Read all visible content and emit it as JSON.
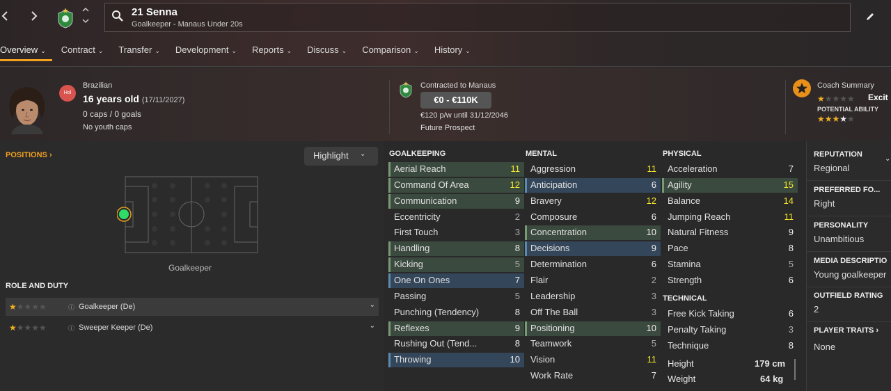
{
  "header": {
    "name": "21 Senna",
    "subtitle": "Goalkeeper - Manaus Under 20s",
    "back_icon": "chevron-left-icon",
    "forward_icon": "chevron-right-icon"
  },
  "tabs": [
    {
      "label": "Overview"
    },
    {
      "label": "Contract"
    },
    {
      "label": "Transfer"
    },
    {
      "label": "Development"
    },
    {
      "label": "Reports"
    },
    {
      "label": "Discuss"
    },
    {
      "label": "Comparison"
    },
    {
      "label": "History"
    }
  ],
  "profile": {
    "badge": "Hol",
    "nationality": "Brazilian",
    "age": "16 years old",
    "dob": "(17/11/2027)",
    "caps": "0 caps / 0 goals",
    "youth": "No youth caps"
  },
  "contract": {
    "title": "Contracted to Manaus",
    "wage_range": "€0 - €110K",
    "terms": "€120 p/w until 31/12/2046",
    "status": "Future Prospect"
  },
  "coach": {
    "title": "Coach Summary",
    "current": "Excit",
    "ca_stars": 1,
    "pa_label": "POTENTIAL ABILITY",
    "pa_stars": 3.5
  },
  "positions": {
    "label": "POSITIONS",
    "highlight": "Highlight",
    "position": "Goalkeeper"
  },
  "roles": {
    "label": "ROLE AND DUTY",
    "items": [
      {
        "name": "Goalkeeper (De)",
        "stars": 1
      },
      {
        "name": "Sweeper Keeper (De)",
        "stars": 1
      }
    ]
  },
  "goalkeeping": {
    "label": "GOALKEEPING",
    "items": [
      {
        "name": "Aerial Reach",
        "value": "11",
        "hl": "g",
        "col": "y"
      },
      {
        "name": "Command Of Area",
        "value": "12",
        "hl": "g",
        "col": "y"
      },
      {
        "name": "Communication",
        "value": "9",
        "hl": "g",
        "col": "w"
      },
      {
        "name": "Eccentricity",
        "value": "2",
        "hl": "",
        "col": "g"
      },
      {
        "name": "First Touch",
        "value": "3",
        "hl": "",
        "col": "g"
      },
      {
        "name": "Handling",
        "value": "8",
        "hl": "g",
        "col": "w"
      },
      {
        "name": "Kicking",
        "value": "5",
        "hl": "g",
        "col": "g"
      },
      {
        "name": "One On Ones",
        "value": "7",
        "hl": "b",
        "col": "w"
      },
      {
        "name": "Passing",
        "value": "5",
        "hl": "",
        "col": "g"
      },
      {
        "name": "Punching (Tendency)",
        "value": "8",
        "hl": "",
        "col": "w"
      },
      {
        "name": "Reflexes",
        "value": "9",
        "hl": "g",
        "col": "w"
      },
      {
        "name": "Rushing Out (Tend...",
        "value": "8",
        "hl": "",
        "col": "w"
      },
      {
        "name": "Throwing",
        "value": "10",
        "hl": "b",
        "col": "w"
      }
    ]
  },
  "mental": {
    "label": "MENTAL",
    "items": [
      {
        "name": "Aggression",
        "value": "11",
        "hl": "",
        "col": "y"
      },
      {
        "name": "Anticipation",
        "value": "6",
        "hl": "b",
        "col": "w"
      },
      {
        "name": "Bravery",
        "value": "12",
        "hl": "",
        "col": "y"
      },
      {
        "name": "Composure",
        "value": "6",
        "hl": "",
        "col": "w"
      },
      {
        "name": "Concentration",
        "value": "10",
        "hl": "g",
        "col": "w"
      },
      {
        "name": "Decisions",
        "value": "9",
        "hl": "b",
        "col": "w"
      },
      {
        "name": "Determination",
        "value": "6",
        "hl": "",
        "col": "w"
      },
      {
        "name": "Flair",
        "value": "2",
        "hl": "",
        "col": "g"
      },
      {
        "name": "Leadership",
        "value": "3",
        "hl": "",
        "col": "g"
      },
      {
        "name": "Off The Ball",
        "value": "3",
        "hl": "",
        "col": "g"
      },
      {
        "name": "Positioning",
        "value": "10",
        "hl": "g",
        "col": "w"
      },
      {
        "name": "Teamwork",
        "value": "5",
        "hl": "",
        "col": "g"
      },
      {
        "name": "Vision",
        "value": "11",
        "hl": "",
        "col": "y"
      },
      {
        "name": "Work Rate",
        "value": "7",
        "hl": "",
        "col": "w"
      }
    ]
  },
  "physical": {
    "label": "PHYSICAL",
    "items": [
      {
        "name": "Acceleration",
        "value": "7",
        "hl": "",
        "col": "w"
      },
      {
        "name": "Agility",
        "value": "15",
        "hl": "g",
        "col": "y"
      },
      {
        "name": "Balance",
        "value": "14",
        "hl": "",
        "col": "y"
      },
      {
        "name": "Jumping Reach",
        "value": "11",
        "hl": "",
        "col": "y"
      },
      {
        "name": "Natural Fitness",
        "value": "9",
        "hl": "",
        "col": "w"
      },
      {
        "name": "Pace",
        "value": "8",
        "hl": "",
        "col": "w"
      },
      {
        "name": "Stamina",
        "value": "5",
        "hl": "",
        "col": "g"
      },
      {
        "name": "Strength",
        "value": "6",
        "hl": "",
        "col": "w"
      }
    ]
  },
  "technical": {
    "label": "TECHNICAL",
    "items": [
      {
        "name": "Free Kick Taking",
        "value": "6",
        "hl": "",
        "col": "w"
      },
      {
        "name": "Penalty Taking",
        "value": "3",
        "hl": "",
        "col": "g"
      },
      {
        "name": "Technique",
        "value": "8",
        "hl": "",
        "col": "w"
      }
    ]
  },
  "body": {
    "height_label": "Height",
    "height": "179 cm",
    "weight_label": "Weight",
    "weight": "64 kg"
  },
  "side": [
    {
      "label": "REPUTATION",
      "value": "Regional"
    },
    {
      "label": "PREFERRED FO...",
      "value": "Right"
    },
    {
      "label": "PERSONALITY",
      "value": "Unambitious"
    },
    {
      "label": "MEDIA DESCRIPTIO",
      "value": "Young goalkeeper"
    },
    {
      "label": "OUTFIELD RATING",
      "value": "2"
    },
    {
      "label": "PLAYER TRAITS",
      "value": "None"
    }
  ]
}
